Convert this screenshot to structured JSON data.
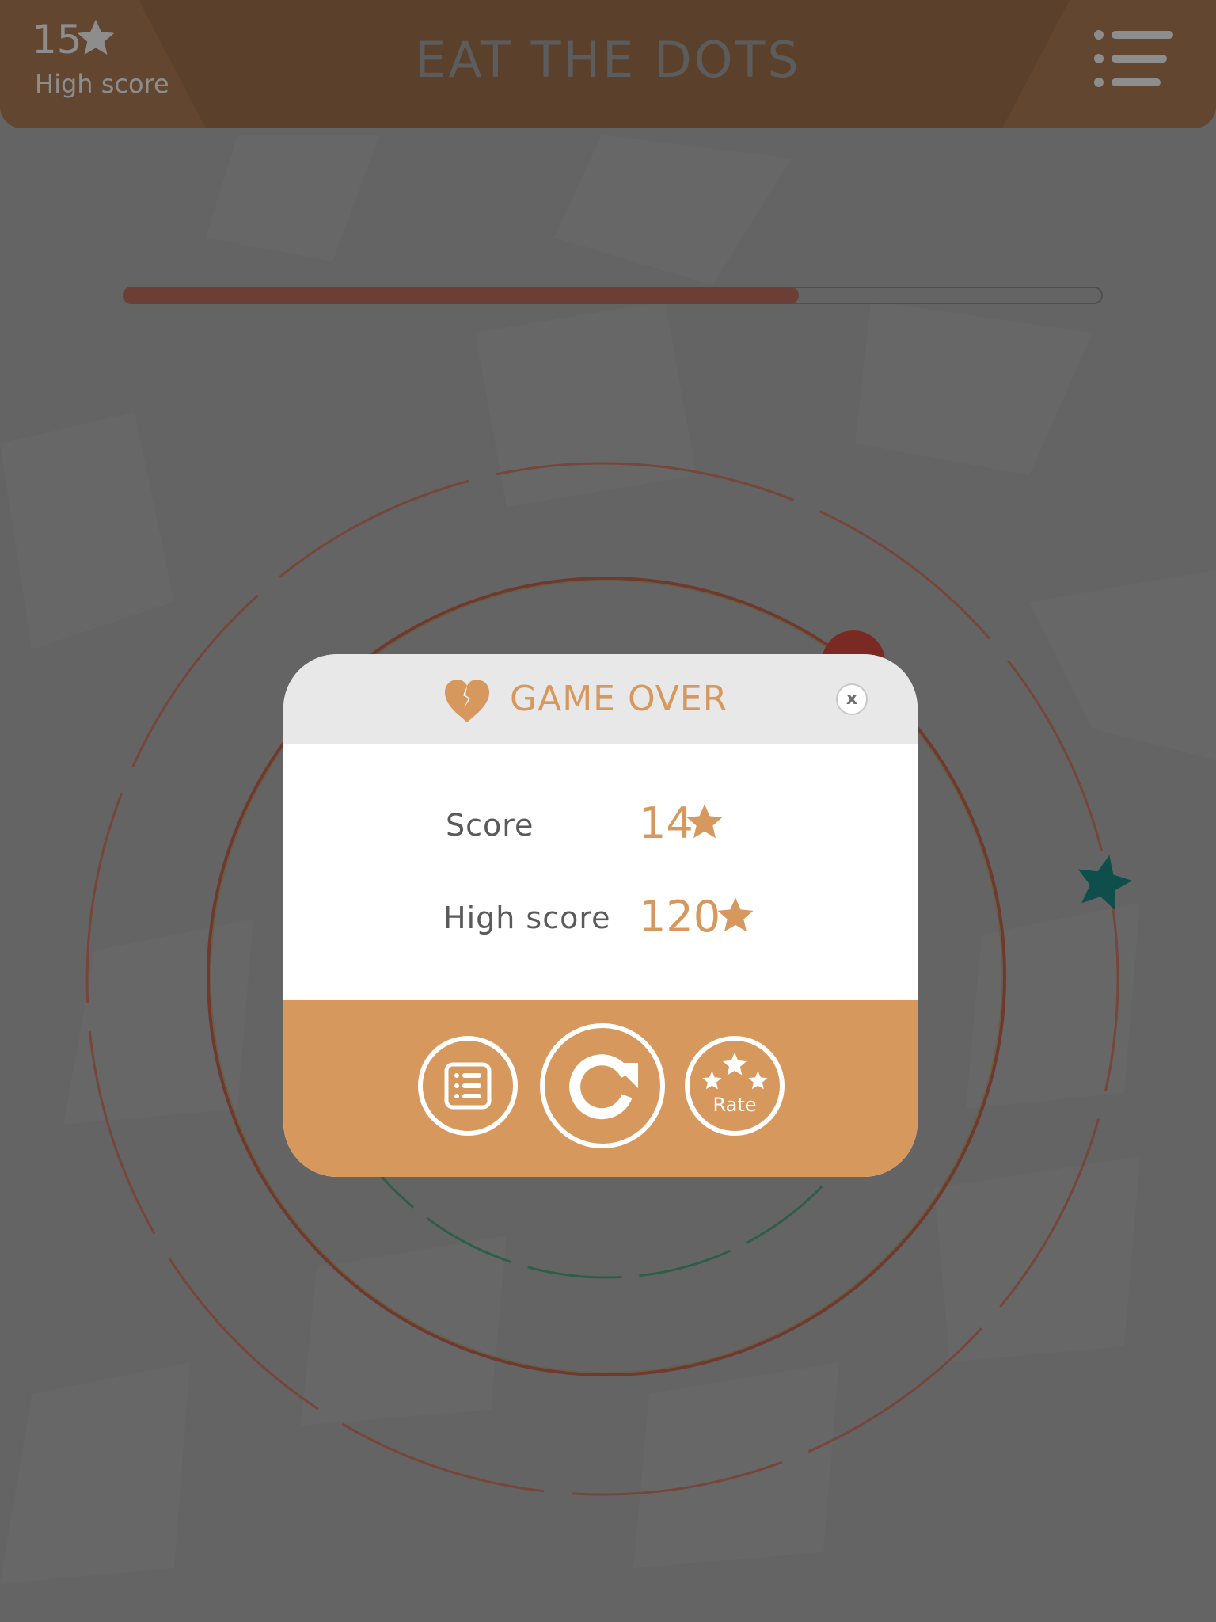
{
  "header": {
    "high_score_value": "15",
    "high_score_label": "High score",
    "title": "EAT THE DOTS"
  },
  "progress": {
    "fraction": 0.69
  },
  "dialog": {
    "title": "GAME OVER",
    "close_label": "x",
    "rows": [
      {
        "label": "Score",
        "value": "14"
      },
      {
        "label": "High score",
        "value": "120"
      }
    ],
    "buttons": {
      "rate_label": "Rate"
    }
  },
  "icons": {
    "header": [
      "star-icon",
      "menu-icon"
    ],
    "dialog": [
      "broken-heart-icon",
      "close-icon",
      "star-icon",
      "leaderboard-icon",
      "replay-icon",
      "rate-stars-icon"
    ],
    "field": [
      "star-icon"
    ]
  },
  "colors": {
    "background": "#646464",
    "header": "#5b412b",
    "accent": "#d6985d",
    "progress_fill": "#6b3f35",
    "side_star": "#0e4e4b"
  }
}
